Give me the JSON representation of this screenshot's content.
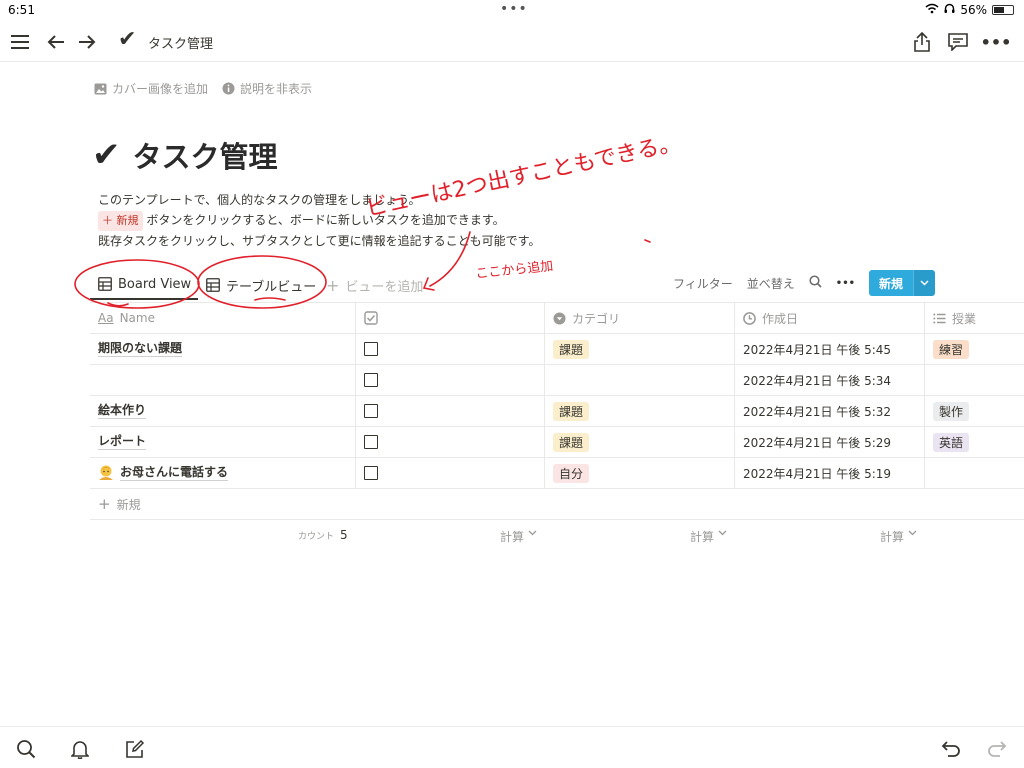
{
  "status": {
    "time": "6:51",
    "battery": "56%",
    "battery_level": 0.56
  },
  "topbar": {
    "page_title": "タスク管理",
    "check": "✔"
  },
  "meta": {
    "add_cover": "カバー画像を追加",
    "hide_desc": "説明を非表示"
  },
  "page": {
    "icon": "✔",
    "title": "タスク管理",
    "desc_line1": "このテンプレートで、個人的なタスクの管理をしましょう。",
    "desc_new_tag": "＋ 新規",
    "desc_line2": "ボタンをクリックすると、ボードに新しいタスクを追加できます。",
    "desc_line3": "既存タスクをクリックし、サブタスクとして更に情報を追記することも可能です。"
  },
  "views": {
    "tabs": [
      "Board View",
      "テーブルビュー"
    ],
    "add_view": "ビューを追加",
    "filter": "フィルター",
    "sort": "並べ替え",
    "more": "•••",
    "new": "新規"
  },
  "table": {
    "headers": {
      "name": "Name",
      "check": "",
      "category": "カテゴリ",
      "created": "作成日",
      "class": "授業"
    },
    "rows": [
      {
        "name": "期限のない課題",
        "category": "課題",
        "created": "2022年4月21日 午後 5:45",
        "class": "練習"
      },
      {
        "name": "",
        "category": "",
        "created": "2022年4月21日 午後 5:34",
        "class": ""
      },
      {
        "name": "絵本作り",
        "category": "課題",
        "created": "2022年4月21日 午後 5:32",
        "class": "製作"
      },
      {
        "name": "レポート",
        "category": "課題",
        "created": "2022年4月21日 午後 5:29",
        "class": "英語"
      },
      {
        "name": "お母さんに電話する",
        "category": "自分",
        "created": "2022年4月21日 午後 5:19",
        "class": ""
      }
    ],
    "add_row": "新規"
  },
  "footer": {
    "count_label": "カウント",
    "count_value": "5",
    "calc": "計算"
  },
  "annotations": {
    "line1": "ビューは2つ出すこともできる。",
    "line2": "ここから追加"
  },
  "colors": {
    "accent": "#2eaadc",
    "tag_kadai": "#fbeecc",
    "tag_jibun": "#fbe4e4",
    "tag_renshu": "#fadec9",
    "tag_seisaku": "#ebeced",
    "tag_eigo": "#eae4f2",
    "annotation": "#e0202a"
  }
}
